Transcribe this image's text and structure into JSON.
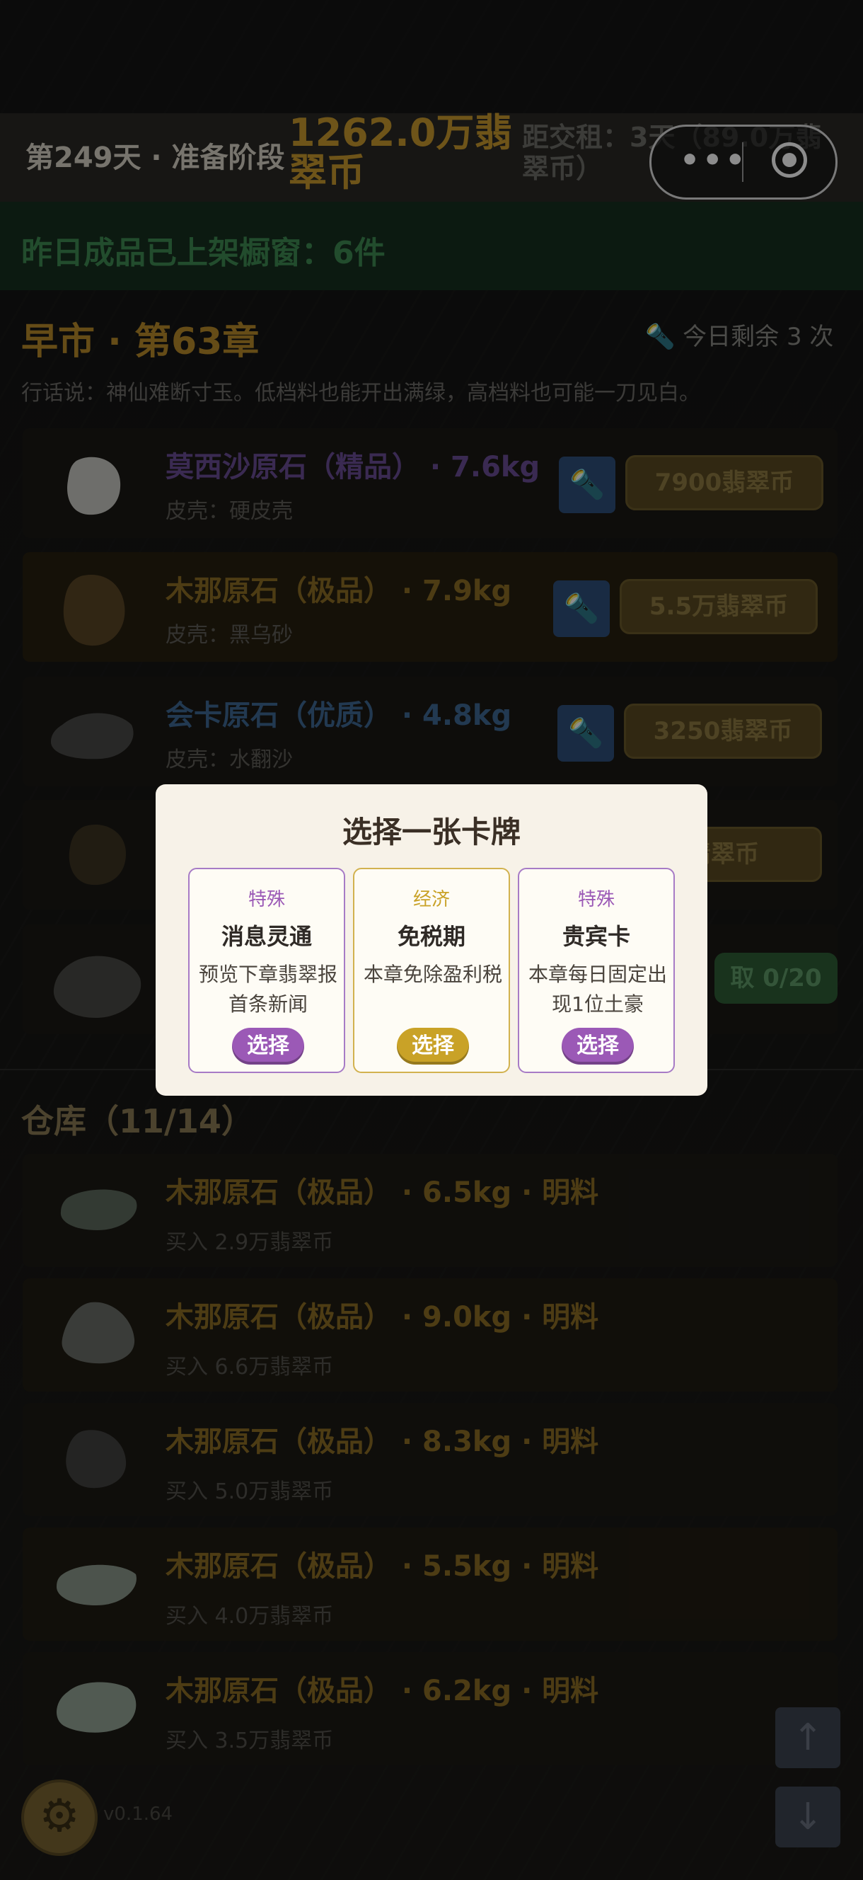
{
  "header": {
    "day": "第249天 · 准备阶段",
    "money": "1262.0万翡翠币",
    "rent": "距交租：3天（89.0万翡翠币）"
  },
  "notice": "昨日成品已上架橱窗：6件",
  "market": {
    "title": "早市 · 第63章",
    "remaining": "今日剩余 3 次",
    "saying": "行话说：神仙难断寸玉。低档料也能开出满绿，高档料也可能一刀见白。",
    "items": [
      {
        "name": "莫西沙原石（精品） · 7.6kg",
        "shell": "皮壳：硬皮壳",
        "price": "7900翡翠币",
        "color": "#6b4e95"
      },
      {
        "name": "木那原石（极品） · 7.9kg",
        "shell": "皮壳：黑乌砂",
        "price": "5.5万翡翠币",
        "color": "#8d6d26"
      },
      {
        "name": "会卡原石（优质） · 4.8kg",
        "shell": "皮壳：水翻沙",
        "price": "3250翡翠币",
        "color": "#3f6994"
      },
      {
        "price": "翡翠币"
      },
      {
        "claim": "取 0/20"
      }
    ]
  },
  "warehouse": {
    "title": "仓库（11/14）",
    "rows": [
      {
        "name": "木那原石（极品） · 6.5kg · 明料",
        "buy": "买入 2.9万翡翠币"
      },
      {
        "name": "木那原石（极品） · 9.0kg · 明料",
        "buy": "买入 6.6万翡翠币"
      },
      {
        "name": "木那原石（极品） · 8.3kg · 明料",
        "buy": "买入 5.0万翡翠币"
      },
      {
        "name": "木那原石（极品） · 5.5kg · 明料",
        "buy": "买入 4.0万翡翠币"
      },
      {
        "name": "木那原石（极品） · 6.2kg · 明料",
        "buy": "买入 3.5万翡翠币"
      }
    ]
  },
  "version": "v0.1.64",
  "icons": {
    "menu": "more-dots-icon",
    "record": "record-icon",
    "flashlight": "flashlight-icon",
    "settings": "gear-icon",
    "scroll_up": "arrow-up-icon",
    "scroll_down": "arrow-down-icon"
  },
  "modal": {
    "title": "选择一张卡牌",
    "cards": [
      {
        "tag": "特殊",
        "name": "消息灵通",
        "desc": "预览下章翡翠报首条新闻",
        "button": "选择",
        "accent": "#9b59b6"
      },
      {
        "tag": "经济",
        "name": "免税期",
        "desc": "本章免除盈利税",
        "button": "选择",
        "accent": "#c9a227"
      },
      {
        "tag": "特殊",
        "name": "贵宾卡",
        "desc": "本章每日固定出现1位土豪",
        "button": "选择",
        "accent": "#9b59b6"
      }
    ]
  }
}
